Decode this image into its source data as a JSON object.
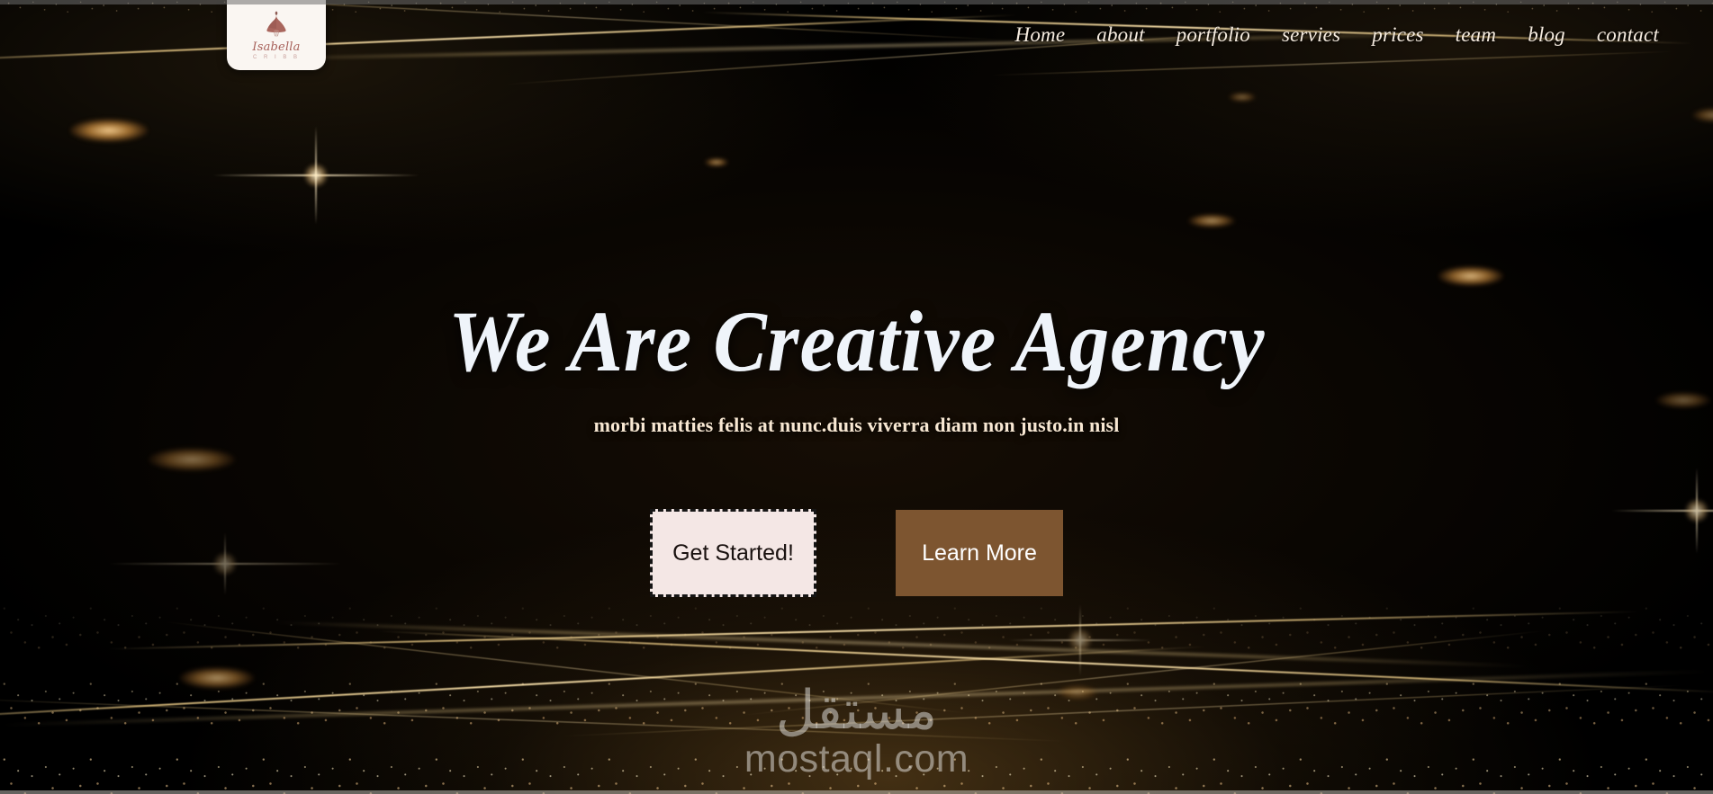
{
  "brand": {
    "logo_name": "Isabella",
    "logo_sub": "C R I B B",
    "logo_icon": "dress-icon"
  },
  "nav": {
    "items": [
      {
        "label": "Home"
      },
      {
        "label": "about"
      },
      {
        "label": "portfolio"
      },
      {
        "label": "servies"
      },
      {
        "label": "prices"
      },
      {
        "label": "team"
      },
      {
        "label": "blog"
      },
      {
        "label": "contact"
      }
    ]
  },
  "hero": {
    "headline": "We Are Creative Agency",
    "subhead": "morbi matties felis at nunc.duis viverra diam non justo.in nisl",
    "primary_cta": "Get Started!",
    "secondary_cta": "Learn More"
  },
  "watermark": {
    "arabic": "مستقل",
    "latin": "mostaql.com"
  },
  "colors": {
    "background": "#000000",
    "nav_text": "#f6ece0",
    "headline": "#eff4fa",
    "subhead": "#f8e8d3",
    "primary_button_bg": "#f4e7e5",
    "primary_button_text": "#19110f",
    "secondary_button_bg": "#7d5530",
    "secondary_button_text": "#ffffff",
    "logo_bg": "#faf6f2",
    "logo_text": "#a8625c",
    "accent_gold": "#e4c480"
  }
}
